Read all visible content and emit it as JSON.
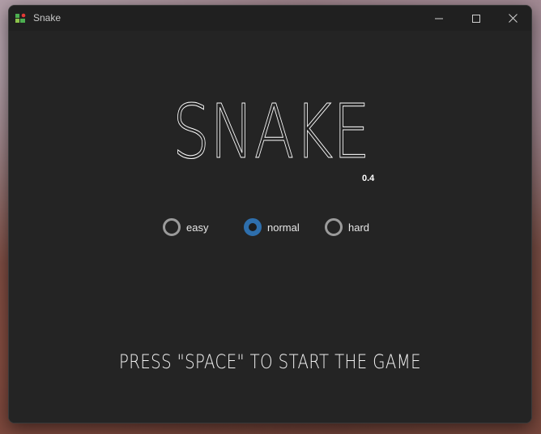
{
  "window": {
    "title": "Snake",
    "controls": {
      "minimize_icon": "minimize-icon",
      "maximize_icon": "maximize-icon",
      "close_icon": "close-icon"
    },
    "app_icon": "snake-app-icon"
  },
  "game": {
    "logo_text": "SNAKE",
    "version": "0.4",
    "difficulty": {
      "options": [
        {
          "label": "easy",
          "selected": false
        },
        {
          "label": "normal",
          "selected": true
        },
        {
          "label": "hard",
          "selected": false
        }
      ]
    },
    "start_prompt": "PRESS \"SPACE\" TO START THE GAME"
  },
  "colors": {
    "window_bg": "#242424",
    "titlebar_bg": "#202020",
    "accent": "#2e6fad",
    "radio_unchecked": "#9b9b9b",
    "text": "#ffffff"
  }
}
